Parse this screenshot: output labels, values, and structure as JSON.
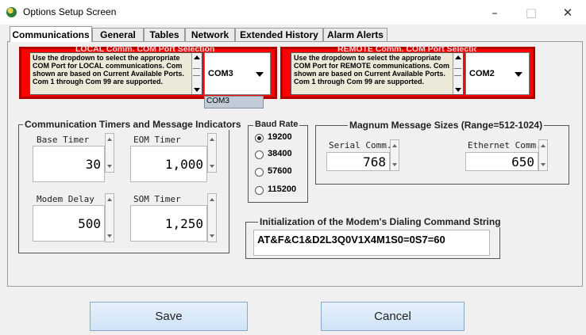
{
  "window": {
    "title": "Options Setup Screen",
    "minimize": "–",
    "maximize": "□",
    "close": "✕"
  },
  "tabs": [
    {
      "label": "Communications",
      "active": true
    },
    {
      "label": "General"
    },
    {
      "label": "Tables"
    },
    {
      "label": "Network"
    },
    {
      "label": "Extended History"
    },
    {
      "label": "Alarm Alerts"
    }
  ],
  "local_com": {
    "title": "LOCAL Comm. COM Port Selection",
    "description": "Use the dropdown to select the appropriate COM Port for LOCAL communications. Com shown are based on Current Available Ports. Com 1 through Com 99 are supported.",
    "selected": "COM3",
    "dropdown_option": "COM3"
  },
  "remote_com": {
    "title": "REMOTE Comm. COM Port Selection",
    "description": "Use the dropdown to select the appropriate COM Port for REMOTE communications. Com shown are based on Current Available Ports. Com 1 through Com 99 are supported.",
    "selected": "COM2"
  },
  "timers": {
    "title": "Communication Timers and Message Indicators",
    "base_timer": {
      "label": "Base Timer",
      "value": "30"
    },
    "eom_timer": {
      "label": "EOM Timer",
      "value": "1,000"
    },
    "modem_delay": {
      "label": "Modem Delay",
      "value": "500"
    },
    "som_timer": {
      "label": "SOM Timer",
      "value": "1,250"
    }
  },
  "baud": {
    "title": "Baud Rate",
    "options": [
      "19200",
      "38400",
      "57600",
      "115200"
    ],
    "selected": "19200"
  },
  "magnum": {
    "title": "Magnum Message Sizes (Range=512-1024)",
    "serial": {
      "label": "Serial Comm.",
      "value": "768"
    },
    "ethernet": {
      "label": "Ethernet Comm.",
      "value": "650"
    }
  },
  "modem_init": {
    "title": "Initialization of the Modem's Dialing Command String",
    "value": "AT&F&C1&D2L3Q0V1X4M1S0=0S7=60"
  },
  "buttons": {
    "save": "Save",
    "cancel": "Cancel"
  }
}
